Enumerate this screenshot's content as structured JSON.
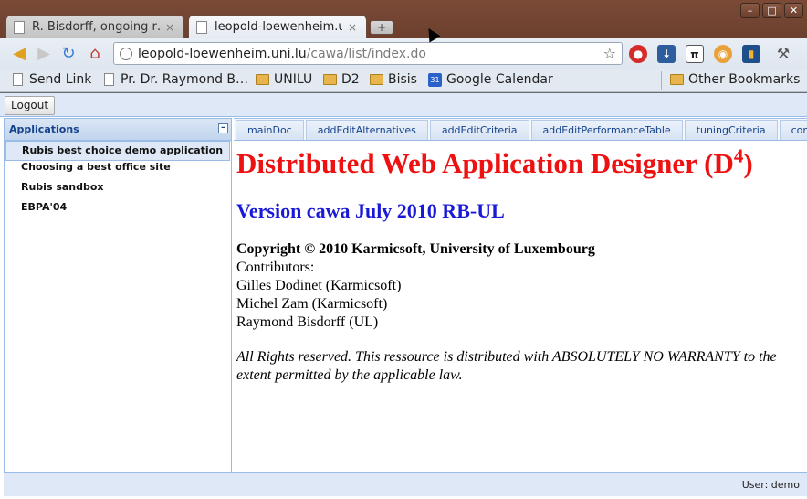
{
  "browser": {
    "tabs": [
      {
        "title": "R. Bisdorff, ongoing r…",
        "close": "×"
      },
      {
        "title": "leopold-loewenheim.u…",
        "close": "×"
      }
    ],
    "new_tab_label": "+",
    "window_controls": {
      "minimize": "–",
      "maximize": "□",
      "close": "✕"
    },
    "address": {
      "host": "leopold-loewenheim.uni.lu",
      "path": "/cawa/list/index.do"
    },
    "bookmarks": [
      {
        "label": "Send Link",
        "icon": "page-icon"
      },
      {
        "label": "Pr. Dr. Raymond B…",
        "icon": "page-icon"
      },
      {
        "label": "UNILU",
        "icon": "folder-icon"
      },
      {
        "label": "D2",
        "icon": "folder-icon"
      },
      {
        "label": "Bisis",
        "icon": "folder-icon"
      },
      {
        "label": "Google Calendar",
        "icon": "calendar-icon",
        "badge": "31"
      },
      {
        "label": "Other Bookmarks",
        "icon": "folder-icon"
      }
    ]
  },
  "app": {
    "logout_label": "Logout",
    "sidebar": {
      "title": "Applications",
      "collapse_label": "–",
      "items": [
        {
          "label": "Rubis best choice demo application",
          "selected": true
        },
        {
          "label": "Choosing a best office site"
        },
        {
          "label": "Rubis sandbox"
        },
        {
          "label": "EBPA'04"
        }
      ]
    },
    "tabs": [
      "mainDoc",
      "addEditAlternatives",
      "addEditCriteria",
      "addEditPerformanceTable",
      "tuningCriteria",
      "compareAlternatives"
    ],
    "doc": {
      "title": "Distributed Web Application Designer (D",
      "title_sup": "4",
      "title_end": ")",
      "version": "Version cawa July 2010 RB-UL",
      "copyright": "Copyright © 2010 Karmicsoft, University of Luxembourg",
      "contributors_label": "Contributors:",
      "contributors": [
        "Gilles Dodinet (Karmicsoft)",
        "Michel Zam (Karmicsoft)",
        "Raymond Bisdorff (UL)"
      ],
      "rights": "All Rights reserved. This ressource is distributed with ABSOLUTELY NO WARRANTY to the extent permitted by the applicable law."
    },
    "status": "User: demo"
  },
  "colors": {
    "title_red": "#ee1111",
    "version_blue": "#1a1ad6",
    "panel_border": "#99bbe8"
  }
}
